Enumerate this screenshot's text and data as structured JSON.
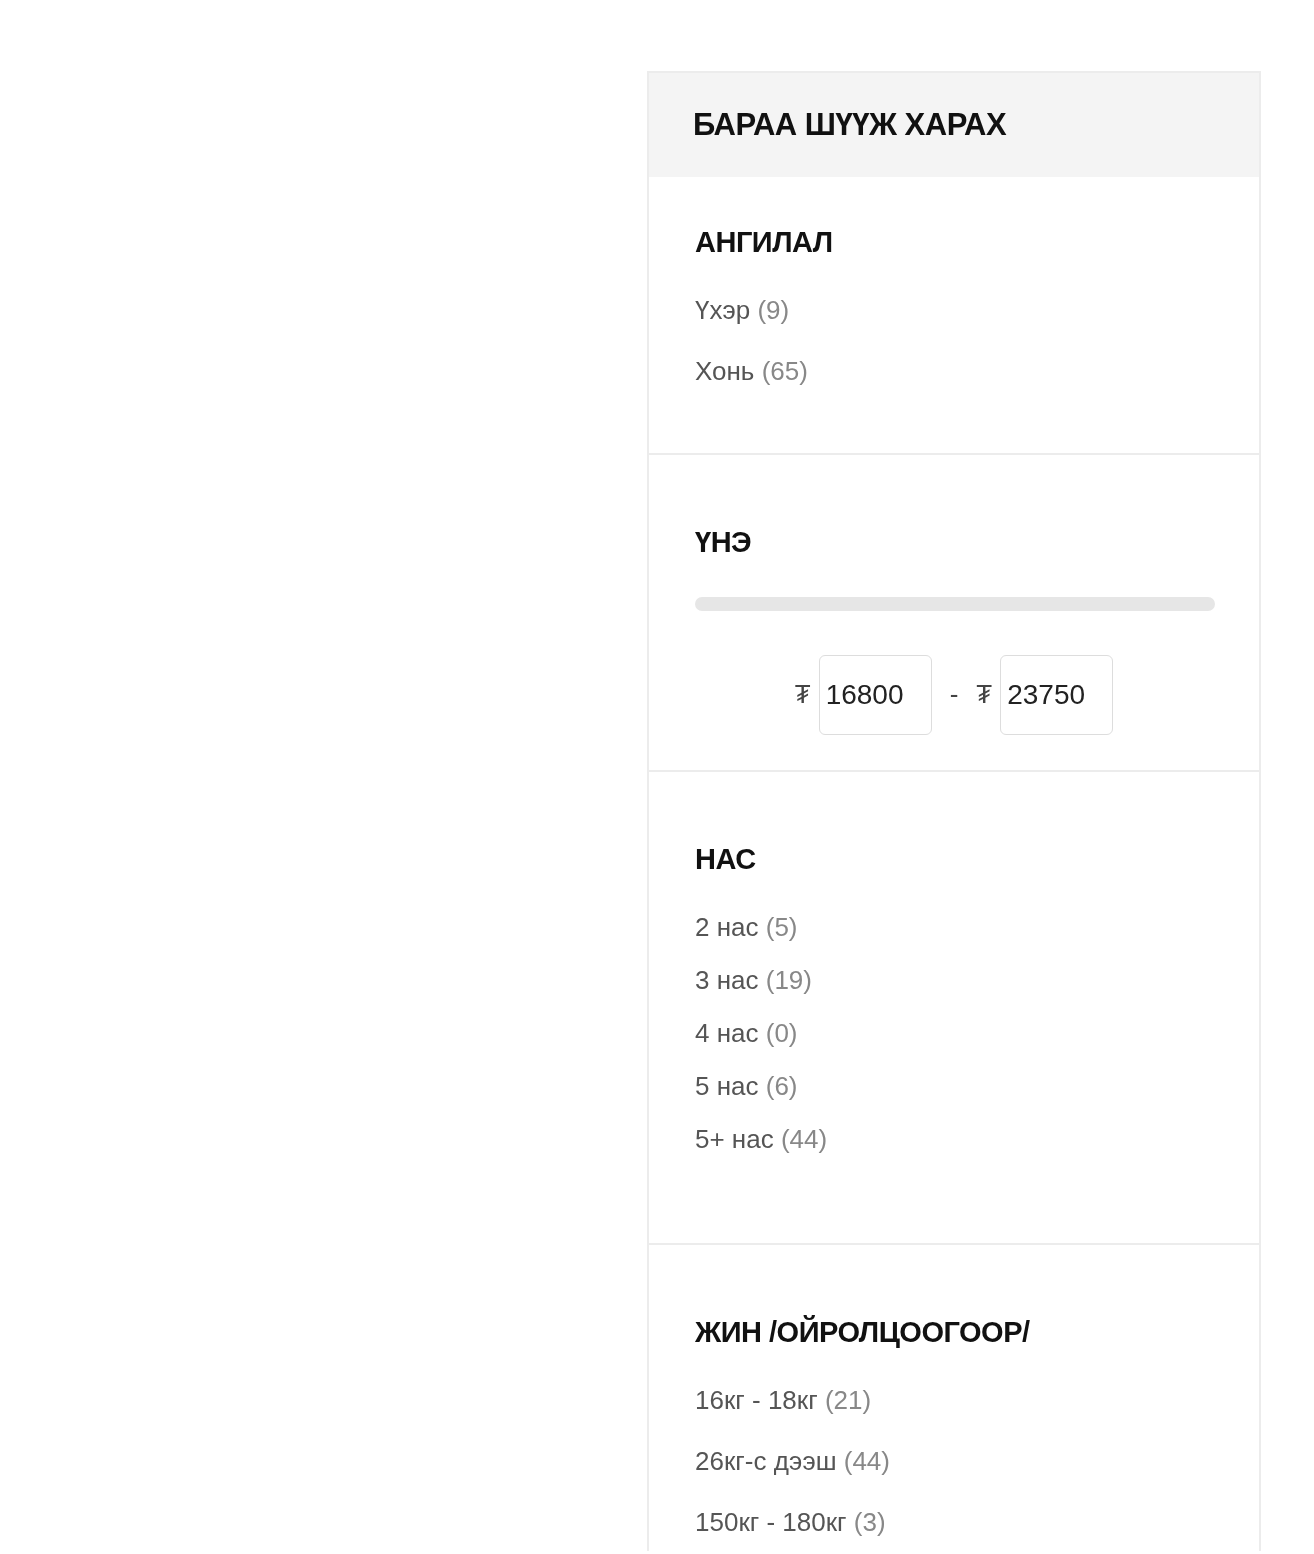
{
  "panel": {
    "title": "БАРАА ШҮҮЖ ХАРАХ"
  },
  "category": {
    "title": "АНГИЛАЛ",
    "items": [
      {
        "label": "Үхэр",
        "count": "(9)"
      },
      {
        "label": "Хонь",
        "count": "(65)"
      }
    ]
  },
  "price": {
    "title": "ҮНЭ",
    "currency_from": "₮",
    "min": "16800",
    "separator": "-",
    "currency_to": "₮",
    "max": "23750"
  },
  "age": {
    "title": "НАС",
    "items": [
      {
        "label": "2 нас",
        "count": "(5)"
      },
      {
        "label": "3 нас",
        "count": "(19)"
      },
      {
        "label": "4 нас",
        "count": "(0)"
      },
      {
        "label": "5 нас",
        "count": "(6)"
      },
      {
        "label": "5+ нас",
        "count": "(44)"
      }
    ]
  },
  "weight": {
    "title": "ЖИН /ОЙРОЛЦООГООР/",
    "items": [
      {
        "label": "16кг - 18кг",
        "count": "(21)"
      },
      {
        "label": "26кг-с дээш",
        "count": "(44)"
      },
      {
        "label": "150кг - 180кг",
        "count": "(3)"
      }
    ]
  }
}
